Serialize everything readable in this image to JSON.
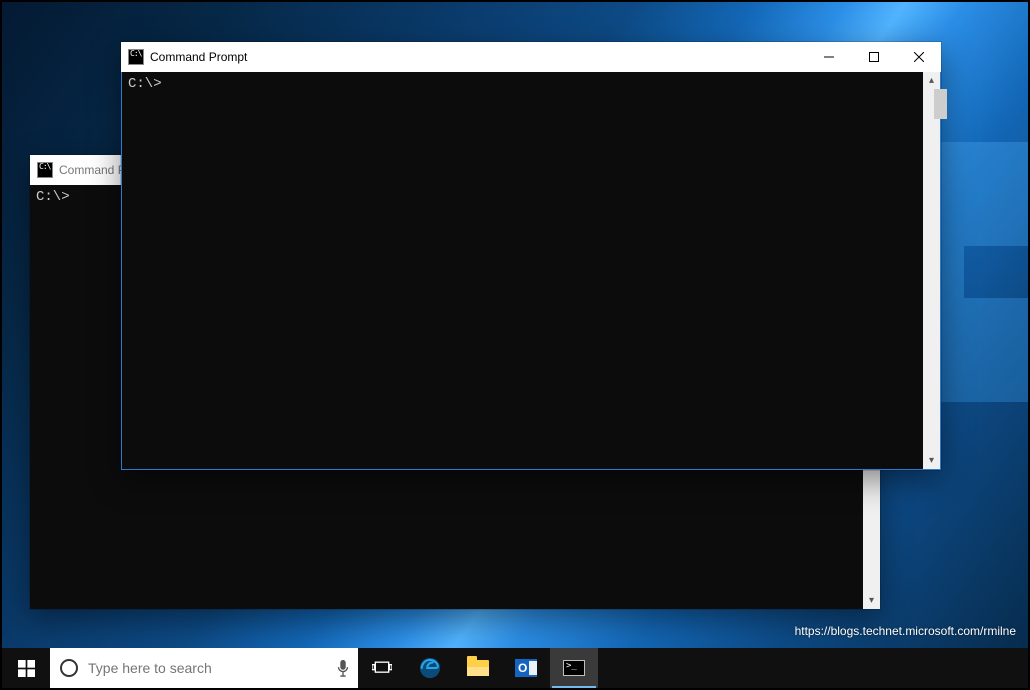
{
  "windows": {
    "back": {
      "title": "Command Prompt",
      "prompt": "C:\\>"
    },
    "front": {
      "title": "Command Prompt",
      "prompt": "C:\\>"
    }
  },
  "taskbar": {
    "search_placeholder": "Type here to search",
    "apps": {
      "edge": "Microsoft Edge",
      "explorer": "File Explorer",
      "outlook": "Outlook",
      "cmd": "Command Prompt"
    }
  },
  "outlook_letter": "O",
  "cmd_icon_text": ">_",
  "credit": "https://blogs.technet.microsoft.com/rmilne"
}
